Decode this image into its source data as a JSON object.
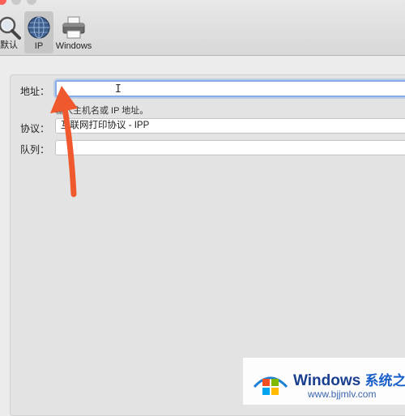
{
  "window": {
    "traffic_lights": [
      "close",
      "minimize",
      "zoom"
    ]
  },
  "toolbar": {
    "items": [
      {
        "label": "默认",
        "icon": "magnifier-icon",
        "selected": false
      },
      {
        "label": "IP",
        "icon": "globe-icon",
        "selected": true
      },
      {
        "label": "Windows",
        "icon": "printer-icon",
        "selected": false
      }
    ]
  },
  "form": {
    "address_label": "地址：",
    "address_value": "",
    "address_hint": "输入主机名或 IP 地址。",
    "protocol_label": "协议：",
    "protocol_value": "互联网打印协议 - IPP",
    "queue_label": "队列：",
    "queue_value": ""
  },
  "annotation": {
    "arrow_color": "#f0592d"
  },
  "watermark": {
    "brand": "Windows",
    "brand_cn": "系统之家",
    "url": "www.bjjmlv.com"
  },
  "colors": {
    "focus_ring": "#86acec",
    "selected_tab": "#c6c6c6"
  }
}
